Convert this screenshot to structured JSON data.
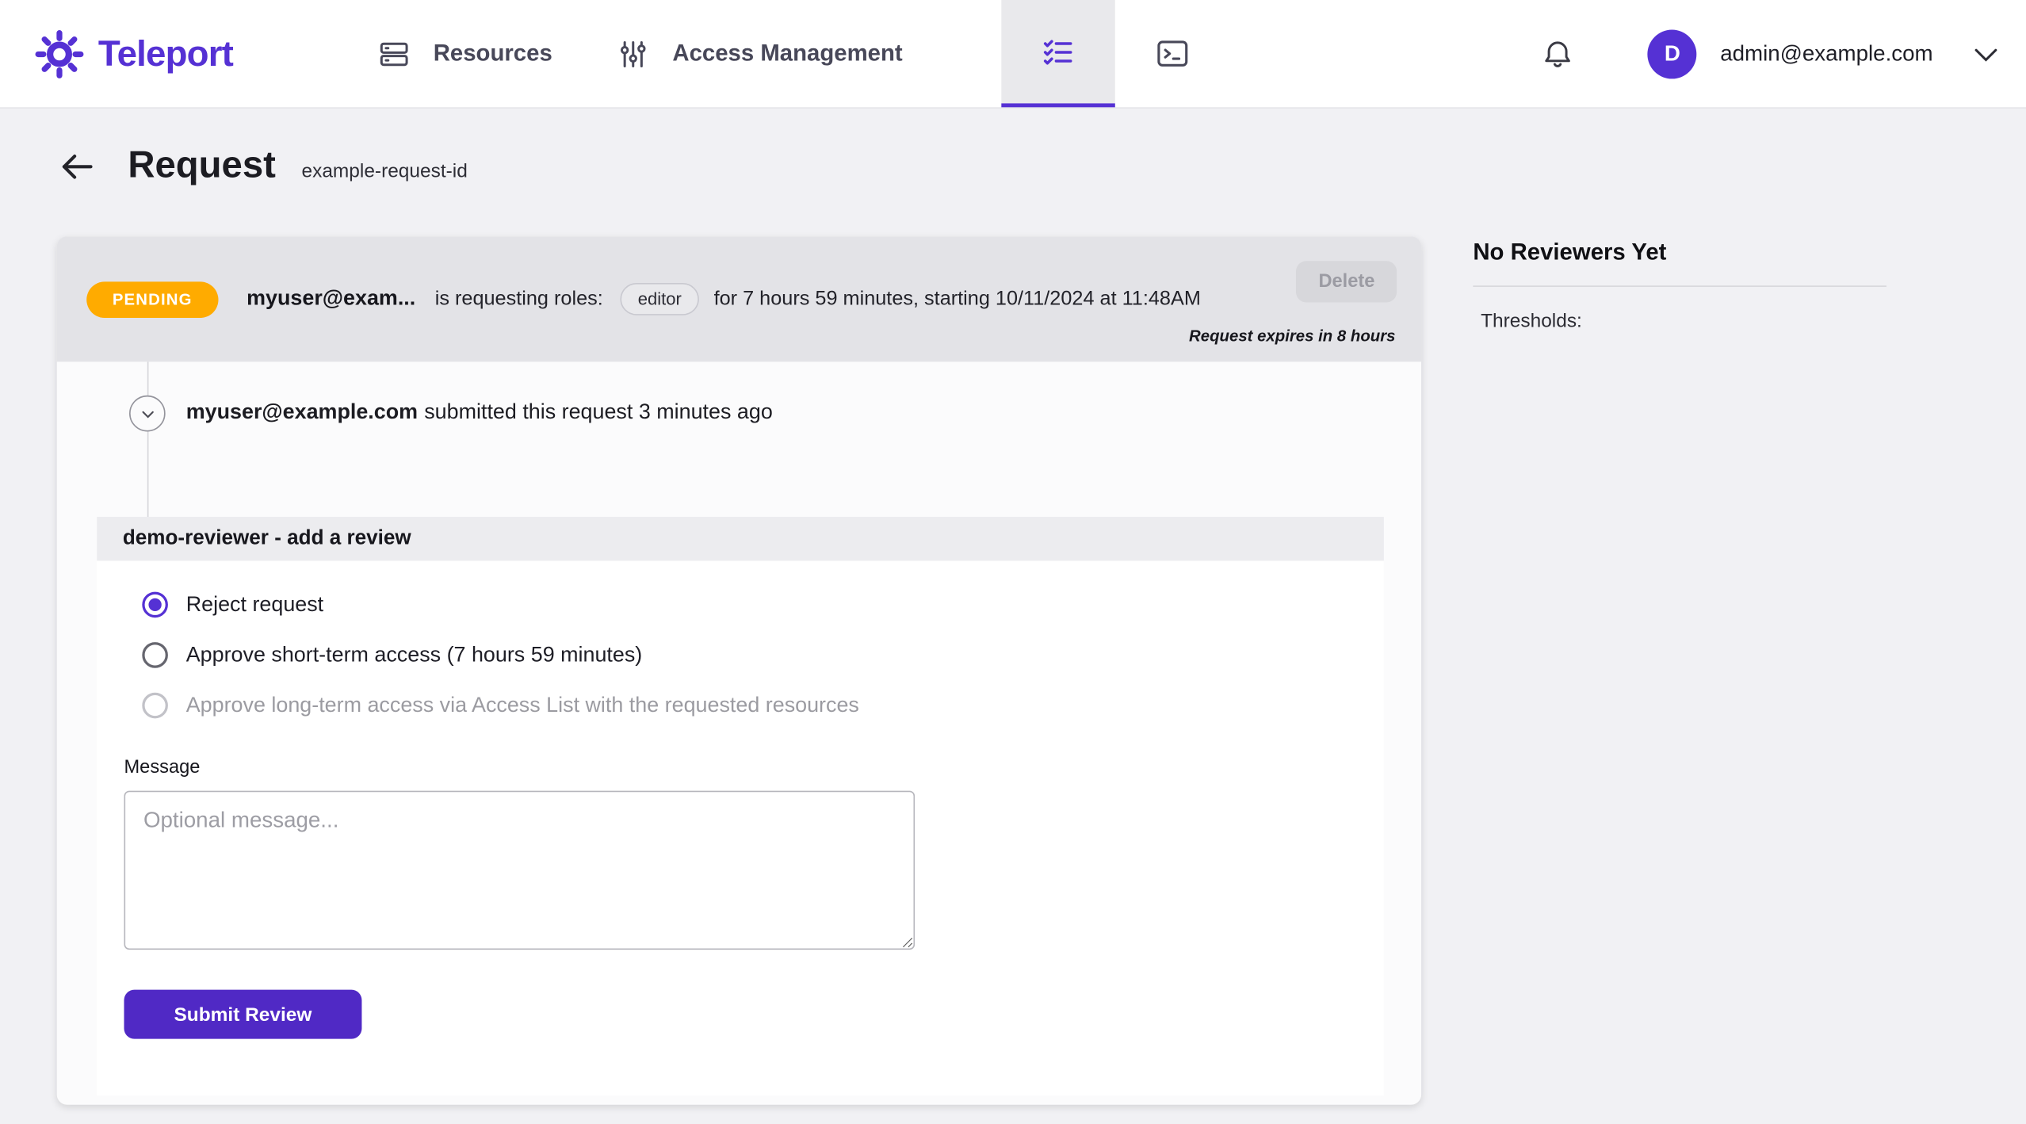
{
  "brand": {
    "name": "Teleport",
    "color": "#5531d4"
  },
  "nav": {
    "items": [
      {
        "label": "Resources"
      },
      {
        "label": "Access Management"
      }
    ],
    "active_tab_icon": "checklist-icon",
    "terminal_tab_icon": "terminal-icon",
    "user_email": "admin@example.com",
    "avatar_letter": "D"
  },
  "page": {
    "title": "Request",
    "subtitle": "example-request-id"
  },
  "request": {
    "status": "PENDING",
    "status_color": "#ffab00",
    "requester": "myuser@exam...",
    "requesting_text": "is requesting roles:",
    "role": "editor",
    "duration_text": "for 7 hours 59 minutes, starting 10/11/2024 at 11:48AM",
    "delete_label": "Delete",
    "expires_text": "Request expires in 8 hours",
    "timeline_user": "myuser@example.com",
    "timeline_rest": "submitted this request 3 minutes ago"
  },
  "review": {
    "header": "demo-reviewer - add a review",
    "options": [
      {
        "label": "Reject request",
        "selected": true,
        "disabled": false
      },
      {
        "label": "Approve short-term access (7 hours 59 minutes)",
        "selected": false,
        "disabled": false
      },
      {
        "label": "Approve long-term access via Access List with the requested resources",
        "selected": false,
        "disabled": true
      }
    ],
    "message_label": "Message",
    "message_placeholder": "Optional message...",
    "submit_label": "Submit Review"
  },
  "sidebar": {
    "title": "No Reviewers Yet",
    "thresholds_label": "Thresholds:"
  }
}
